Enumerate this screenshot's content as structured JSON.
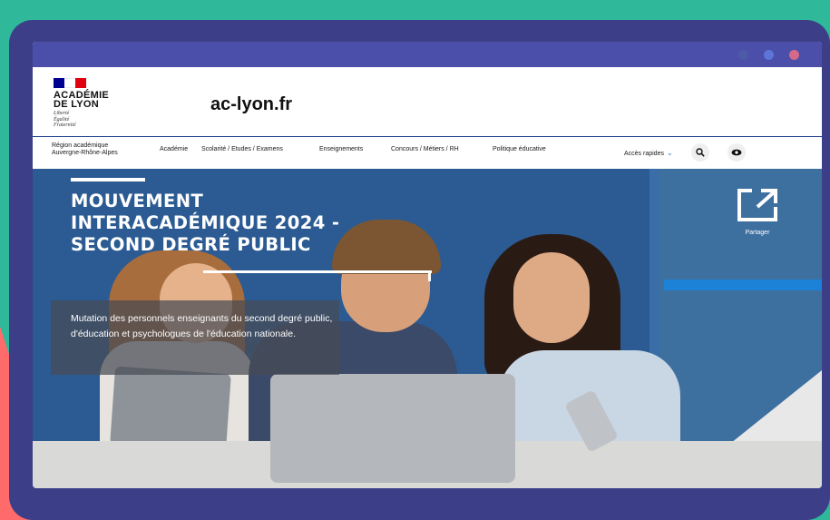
{
  "header": {
    "institution_line1": "ACADÉMIE",
    "institution_line2": "DE LYON",
    "motto_line1": "Liberté",
    "motto_line2": "Égalité",
    "motto_line3": "Fraternité",
    "site_title": "ac-lyon.fr"
  },
  "nav": {
    "items": [
      {
        "line1": "Région académique",
        "line2": "Auvergne-Rhône-Alpes"
      },
      {
        "label": "Académie"
      },
      {
        "label": "Scolarité / Etudes / Examens"
      },
      {
        "label": "Enseignements"
      },
      {
        "label": "Concours / Métiers / RH"
      },
      {
        "label": "Politique éducative"
      }
    ],
    "quick_access": "Accès rapides"
  },
  "hero": {
    "title_line1": "MOUVEMENT",
    "title_line2": "INTERACADÉMIQUE 2024 -",
    "title_line3": "SECOND DEGRÉ PUBLIC",
    "description": "Mutation des personnels enseignants du second degré public, d'éducation et psychologues de l'éducation nationale.",
    "share_label": "Partager"
  },
  "colors": {
    "background": "#2fb99a",
    "device_frame": "#3c3f88",
    "nav_border": "#1c3f8c",
    "accent_blue": "#1b82d8"
  },
  "icons": [
    "search-icon",
    "eye-icon",
    "share-icon",
    "chevron-down-icon"
  ]
}
